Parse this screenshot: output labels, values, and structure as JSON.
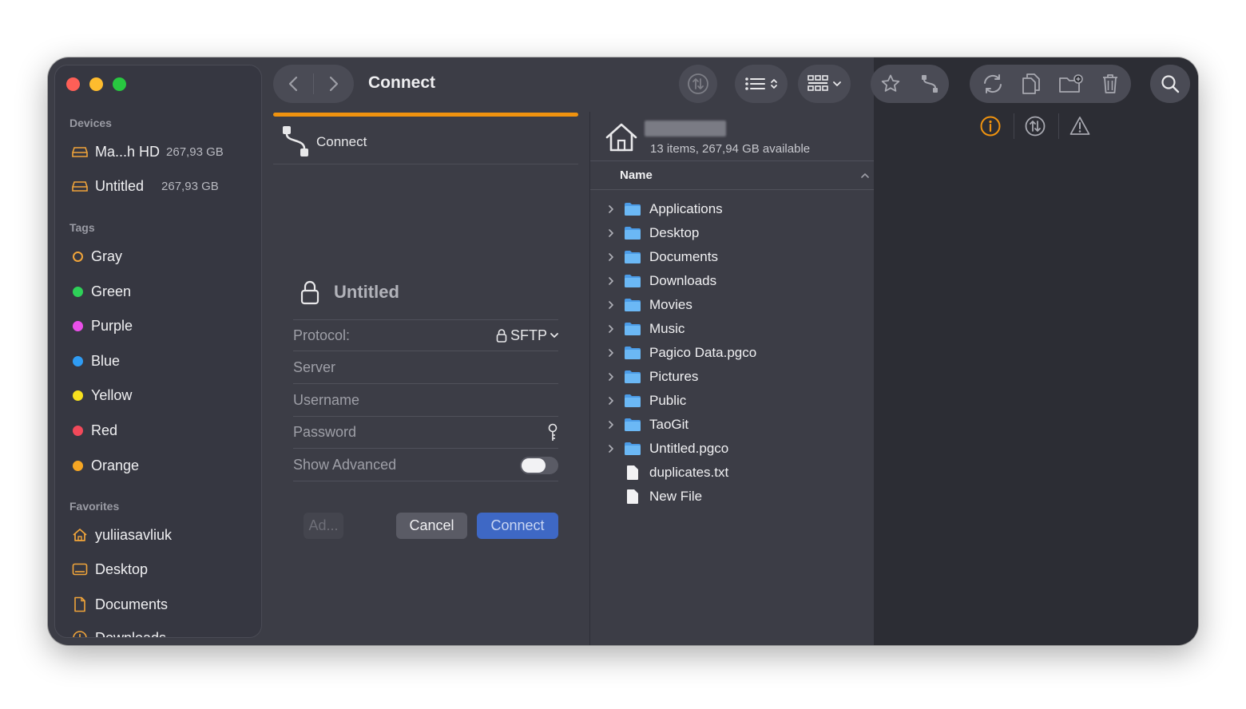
{
  "window": {
    "title": "Connect"
  },
  "sidebar": {
    "devices_heading": "Devices",
    "devices": [
      {
        "name": "Ma...h HD",
        "size": "267,93 GB"
      },
      {
        "name": "Untitled",
        "size": "267,93 GB"
      }
    ],
    "tags_heading": "Tags",
    "tags": [
      {
        "name": "Gray",
        "color": "#f0a43a"
      },
      {
        "name": "Green",
        "color": "#2ed158"
      },
      {
        "name": "Purple",
        "color": "#e94fe9"
      },
      {
        "name": "Blue",
        "color": "#2f9cf4"
      },
      {
        "name": "Yellow",
        "color": "#f7e01e"
      },
      {
        "name": "Red",
        "color": "#f2495a"
      },
      {
        "name": "Orange",
        "color": "#f6a623"
      }
    ],
    "favorites_heading": "Favorites",
    "favorites": [
      {
        "name": "yuliiasavliuk",
        "icon": "home-icon"
      },
      {
        "name": "Desktop",
        "icon": "desktop-icon"
      },
      {
        "name": "Documents",
        "icon": "document-icon"
      },
      {
        "name": "Downloads",
        "icon": "download-icon"
      }
    ]
  },
  "connect_panel": {
    "header_label": "Connect",
    "connection_name": "Untitled",
    "protocol_label": "Protocol:",
    "protocol_value": "SFTP",
    "server_placeholder": "Server",
    "username_placeholder": "Username",
    "password_placeholder": "Password",
    "show_advanced_label": "Show Advanced",
    "show_advanced_on": false,
    "add_button": "Ad...",
    "cancel_button": "Cancel",
    "connect_button": "Connect"
  },
  "file_pane": {
    "info": "13 items, 267,94 GB available",
    "column_name": "Name",
    "items": [
      {
        "name": "Applications",
        "type": "folder"
      },
      {
        "name": "Desktop",
        "type": "folder"
      },
      {
        "name": "Documents",
        "type": "folder"
      },
      {
        "name": "Downloads",
        "type": "folder"
      },
      {
        "name": "Movies",
        "type": "folder"
      },
      {
        "name": "Music",
        "type": "folder"
      },
      {
        "name": "Pagico Data.pgco",
        "type": "folder"
      },
      {
        "name": "Pictures",
        "type": "folder"
      },
      {
        "name": "Public",
        "type": "folder"
      },
      {
        "name": "TaoGit",
        "type": "folder"
      },
      {
        "name": "Untitled.pgco",
        "type": "folder"
      },
      {
        "name": "duplicates.txt",
        "type": "file"
      },
      {
        "name": "New File",
        "type": "file"
      }
    ]
  },
  "colors": {
    "accent_orange": "#f0930f",
    "connect_blue": "#3e68c5",
    "folder_blue": "#5aaef0"
  }
}
